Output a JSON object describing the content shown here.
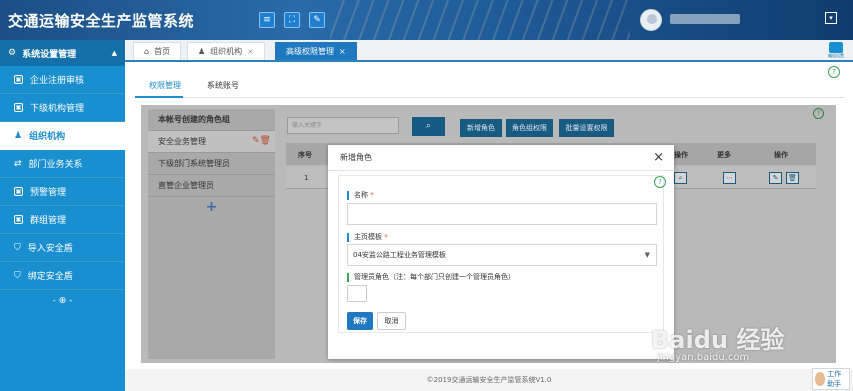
{
  "header": {
    "app_title": "交通运输安全生产监管系统",
    "buttons": [
      {
        "icon": "menu-icon",
        "glyph": "≡"
      },
      {
        "icon": "expand-icon",
        "glyph": "⛶"
      },
      {
        "icon": "edit-icon",
        "glyph": "✎"
      }
    ],
    "user_caret": "▾"
  },
  "sidebar": {
    "title": "系统设置管理",
    "title_icon": "⚙",
    "caret": "▲",
    "items": [
      {
        "label": "企业注册审核",
        "icon": "▣",
        "active": false
      },
      {
        "label": "下级机构管理",
        "icon": "▣",
        "active": false
      },
      {
        "label": "组织机构",
        "icon": "♟",
        "active": true
      },
      {
        "label": "部门业务关系",
        "icon": "⇄",
        "active": false
      },
      {
        "label": "预警管理",
        "icon": "▣",
        "active": false
      },
      {
        "label": "群组管理",
        "icon": "▣",
        "active": false
      },
      {
        "label": "导入安全盾",
        "icon": "⛉",
        "active": false
      },
      {
        "label": "绑定安全盾",
        "icon": "⛉",
        "active": false
      }
    ],
    "footer": "- ⊕ -"
  },
  "tabs": [
    {
      "label": "首页",
      "icon": "⌂",
      "closable": false,
      "active": false
    },
    {
      "label": "组织机构",
      "icon": "♟",
      "closable": true,
      "active": false
    },
    {
      "label": "高级权限管理",
      "icon": "",
      "closable": true,
      "active": true
    }
  ],
  "sub_tabs": [
    {
      "label": "权限管理",
      "active": true
    },
    {
      "label": "系统账号",
      "active": false
    }
  ],
  "roles_panel": {
    "title": "本帐号创建的角色组",
    "items": [
      "安全业务管理",
      "下级部门系统管理员",
      "直管企业管理员"
    ],
    "add": "+"
  },
  "toolbar": {
    "search_placeholder": "输入关键字",
    "search_glyph": "🔍",
    "buttons": [
      "新增角色",
      "角色组权限",
      "批量设置权限"
    ]
  },
  "table": {
    "headers": [
      "序号",
      "操作",
      "更多",
      "操作"
    ],
    "rows": [
      {
        "index": "1"
      }
    ]
  },
  "modal": {
    "title": "新增角色",
    "close": "×",
    "fields": {
      "name_label": "名称",
      "required_mark": "*",
      "homepage_label": "主页模板",
      "homepage_value": "04安监公路工程业务管理模板",
      "admin_label": "管理员角色（注：每个部门只创建一个管理员角色）"
    },
    "save_label": "保存",
    "cancel_label": "取消"
  },
  "footer": {
    "copyright": "©2019交通运输安全生产监管系统V1.0"
  },
  "widgets": {
    "side_label": "编组设置",
    "work_label": "工作\n助手"
  },
  "watermark": {
    "text": "Baidu 经验",
    "url": "jingyan.baidu.com"
  },
  "colors": {
    "sidebar_bg": "#1a8fcf",
    "active_tab": "#1f78c0",
    "action_button": "#175b82",
    "help_icon": "#3aa55a",
    "required": "#d9534f"
  }
}
